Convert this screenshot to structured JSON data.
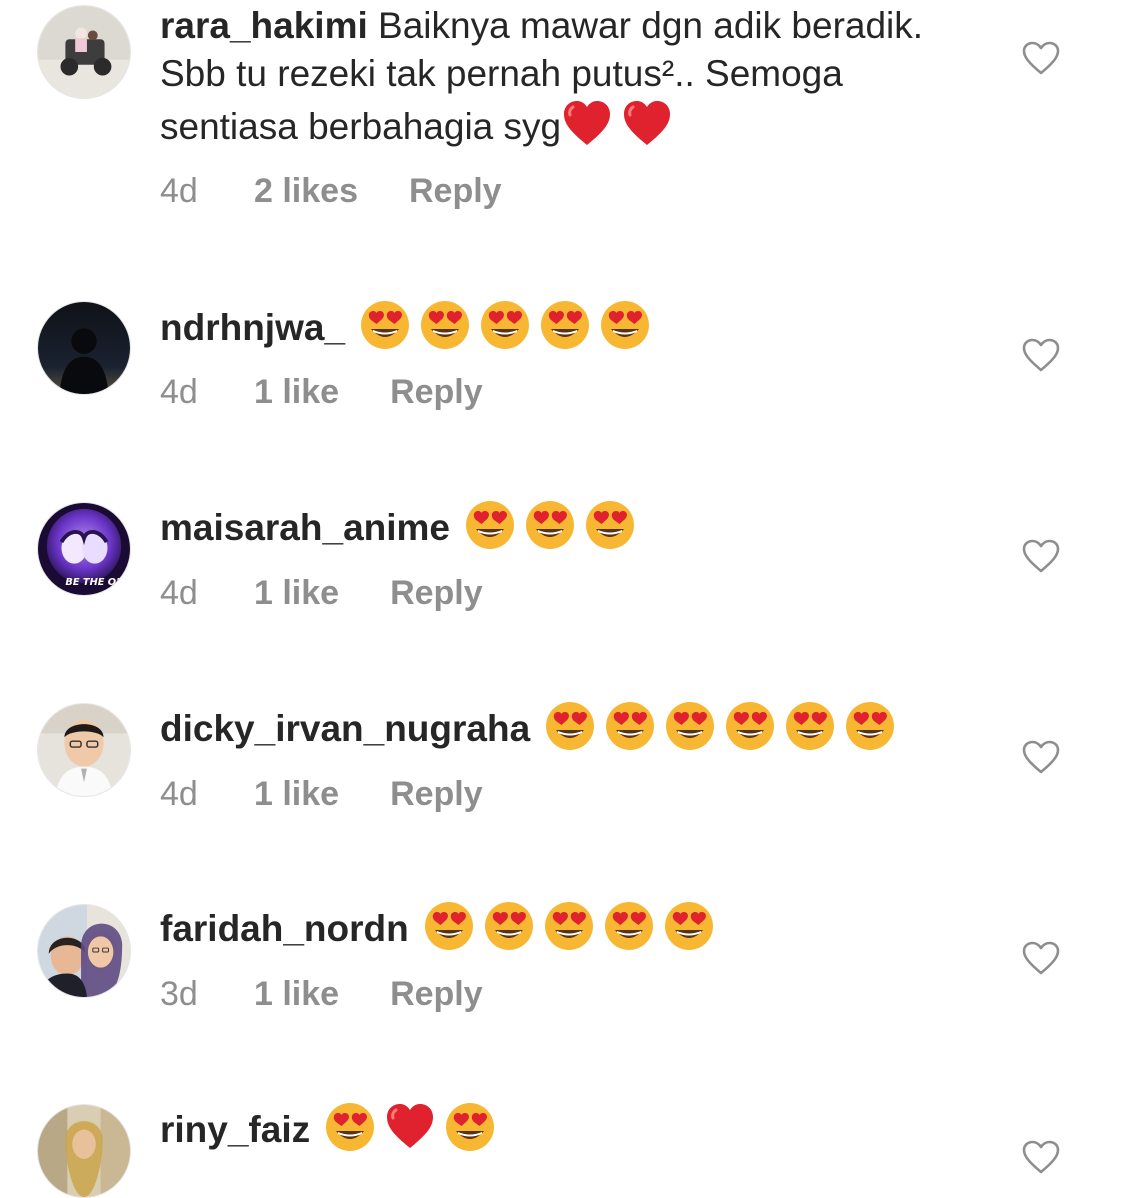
{
  "comments": [
    {
      "username": "rara_hakimi",
      "text": "Baiknya mawar dgn adik beradik. Sbb tu rezeki tak pernah putus².. Semoga sentiasa berbahagia syg",
      "emojis": [
        "red-heart",
        "red-heart"
      ],
      "time": "4d",
      "likes": "2 likes",
      "reply": "Reply",
      "avatar": "avatar-photo-beach-buggy"
    },
    {
      "username": "ndrhnjwa_",
      "text": "",
      "emojis": [
        "heart-eyes",
        "heart-eyes",
        "heart-eyes",
        "heart-eyes",
        "heart-eyes"
      ],
      "time": "4d",
      "likes": "1 like",
      "reply": "Reply",
      "avatar": "avatar-photo-silhouette"
    },
    {
      "username": "maisarah_anime",
      "text": "",
      "emojis": [
        "heart-eyes",
        "heart-eyes",
        "heart-eyes"
      ],
      "time": "4d",
      "likes": "1 like",
      "reply": "Reply",
      "avatar": "avatar-anime-logo",
      "avatar_text": "BE THE ONE"
    },
    {
      "username": "dicky_irvan_nugraha",
      "text": "",
      "emojis": [
        "heart-eyes",
        "heart-eyes",
        "heart-eyes",
        "heart-eyes",
        "heart-eyes",
        "heart-eyes"
      ],
      "time": "4d",
      "likes": "1 like",
      "reply": "Reply",
      "avatar": "avatar-photo-boy"
    },
    {
      "username": "faridah_nordn",
      "text": "",
      "emojis": [
        "heart-eyes",
        "heart-eyes",
        "heart-eyes",
        "heart-eyes",
        "heart-eyes"
      ],
      "time": "3d",
      "likes": "1 like",
      "reply": "Reply",
      "avatar": "avatar-photo-mother-child"
    },
    {
      "username": "riny_faiz",
      "text": "",
      "emojis": [
        "heart-eyes",
        "red-heart",
        "heart-eyes"
      ],
      "time": "",
      "likes": "",
      "reply": "",
      "avatar": "avatar-photo-woman"
    }
  ],
  "colors": {
    "text": "#262626",
    "meta": "#8e8e8e",
    "heart_outline": "#8e8e8e",
    "emoji_face": "#f7b733",
    "emoji_heart": "#e0212e"
  }
}
